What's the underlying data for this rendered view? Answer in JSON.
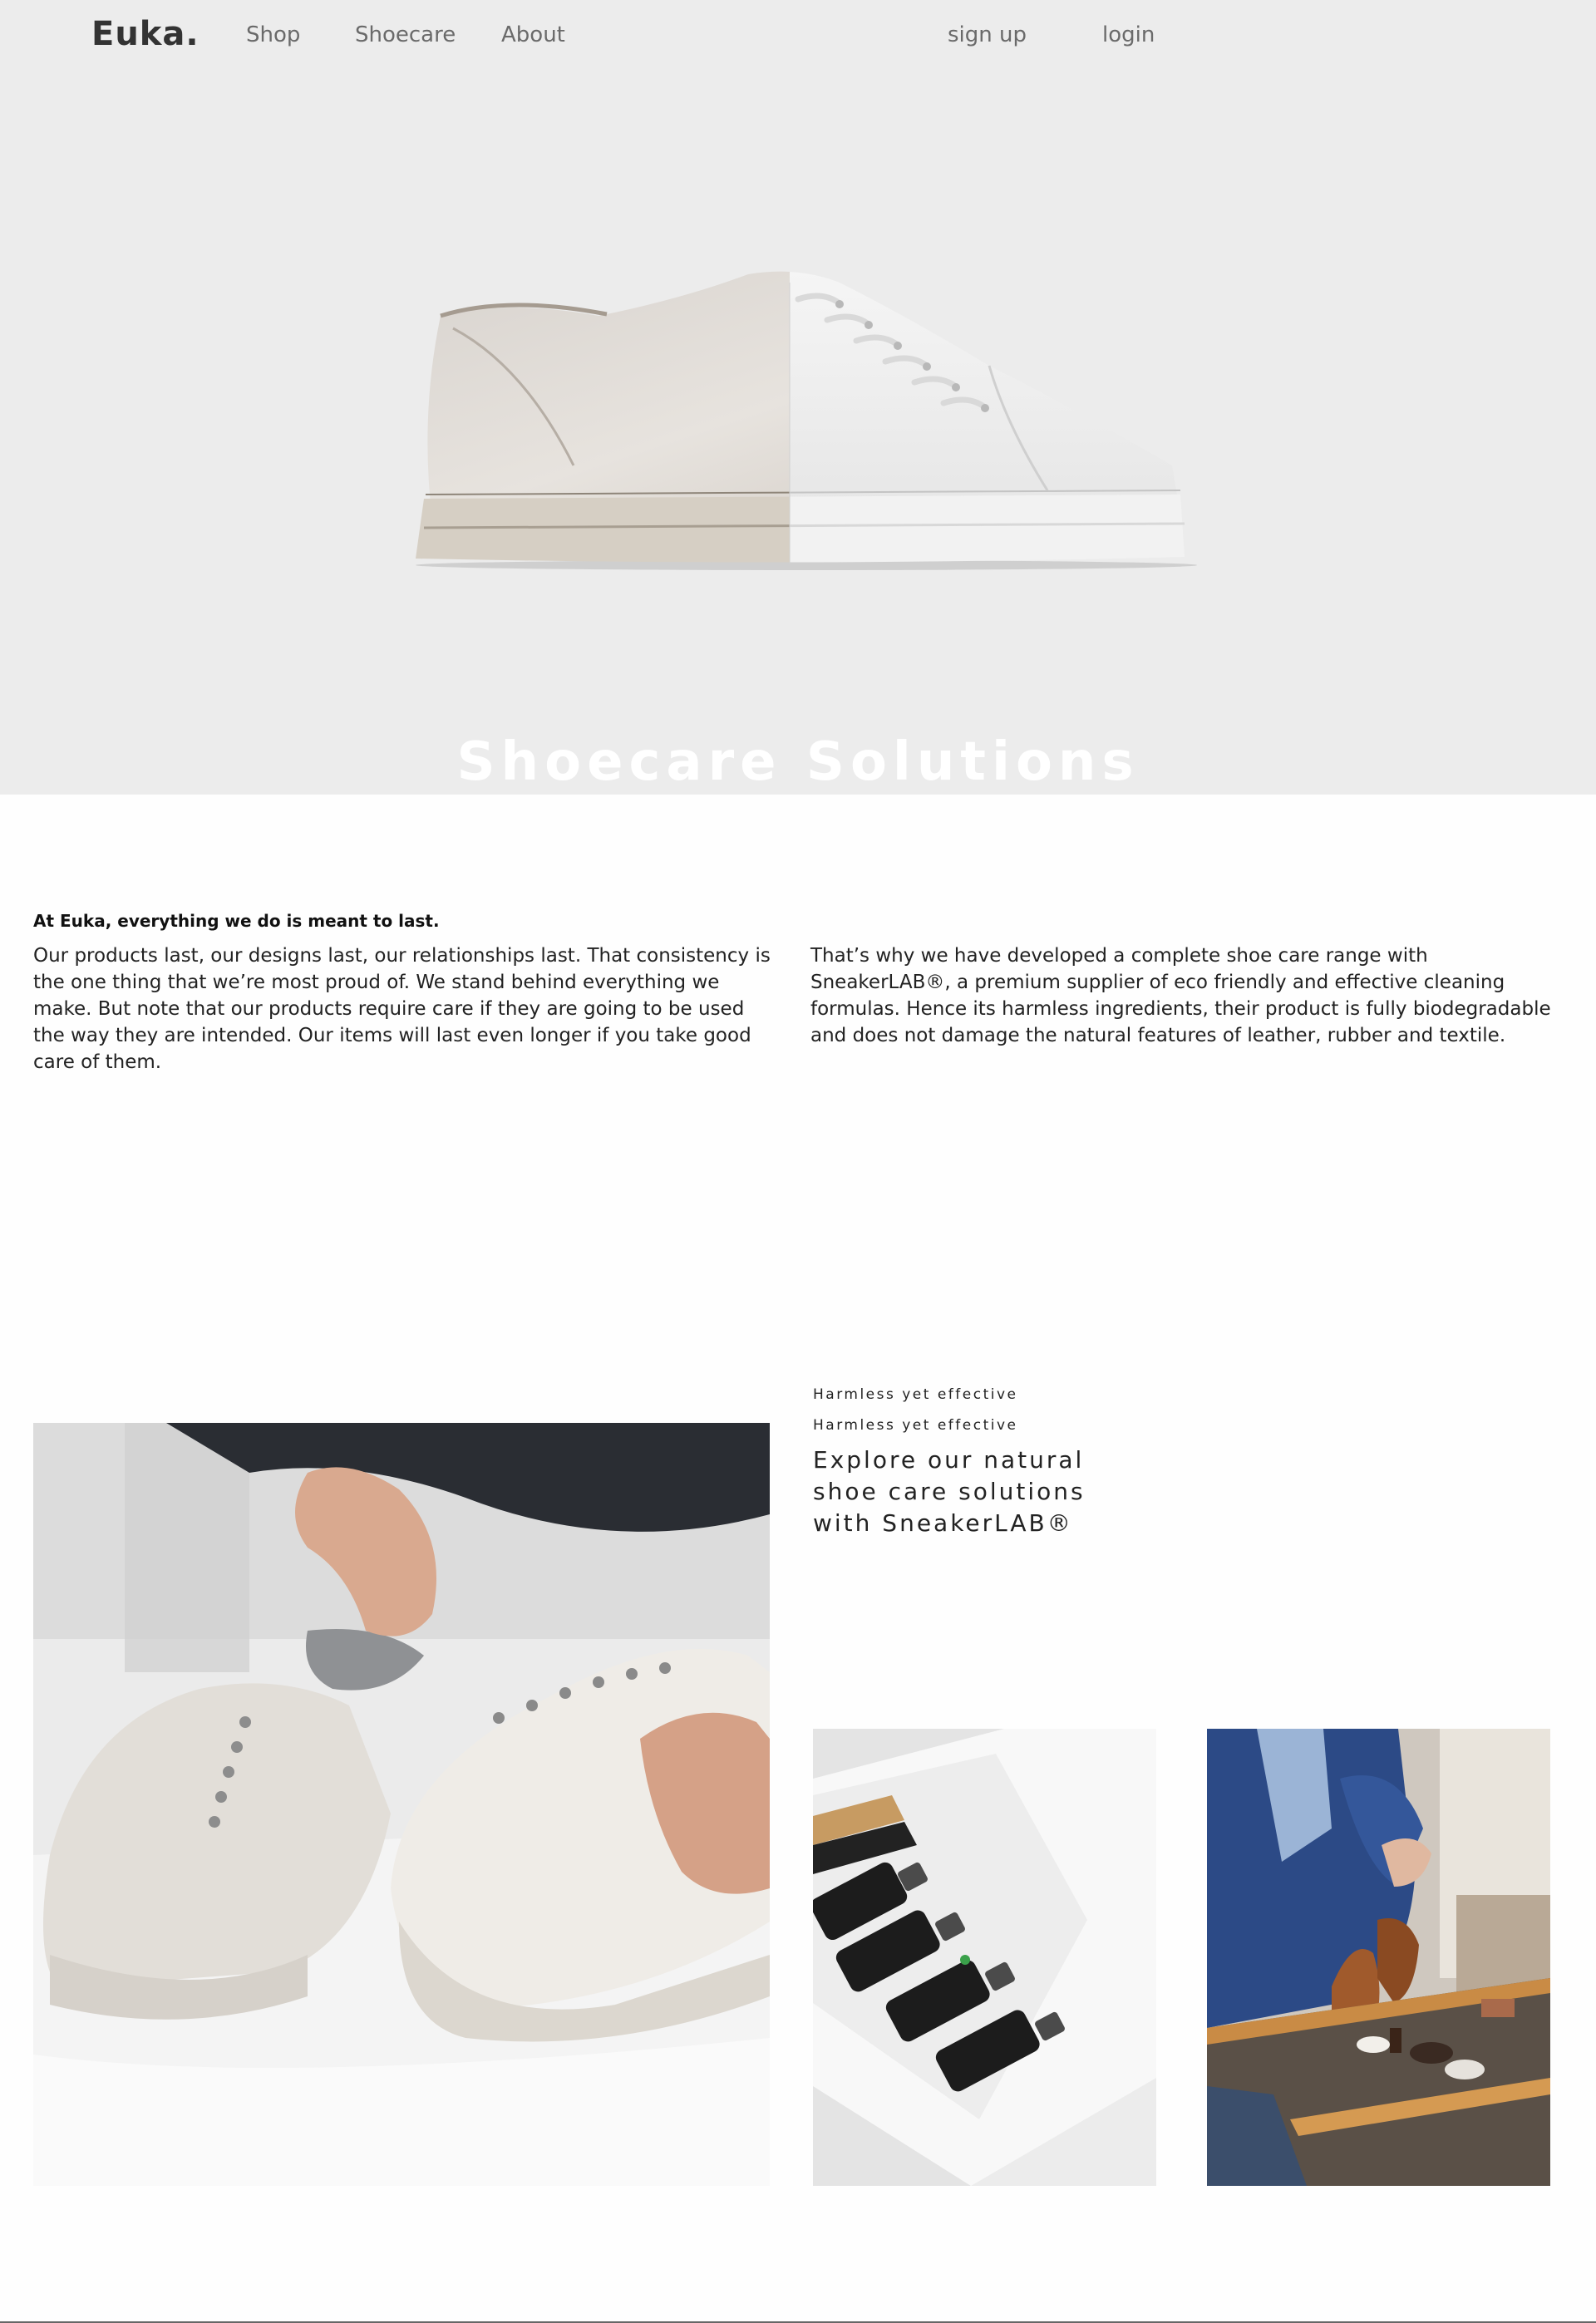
{
  "nav": {
    "logo": "Euka.",
    "links": [
      {
        "label": "Shop"
      },
      {
        "label": "Shoecare"
      },
      {
        "label": "About"
      }
    ],
    "signup_label": "sign up",
    "login_label": "login"
  },
  "hero": {
    "title": "Shoecare Solutions",
    "background_color": "#ececec"
  },
  "intro": {
    "lead": "At Euka, everything we do is meant to last.",
    "left_paragraph": "Our products last, our designs last, our relationships last. That consistency is the one thing that we’re most proud of. We stand behind everything we make. But note that our products require care if they are going to be used the way they are intended. Our items will last even longer if you take good care of them.",
    "right_paragraph": "That’s why we have developed a complete shoe care range with SneakerLAB®, a premium supplier of eco friendly and effective cleaning formulas. Hence its harmless ingredients, their product is fully biodegradable and does not damage the natural features of leather, rubber and textile."
  },
  "feature": {
    "eyebrow": "Harmless yet effective",
    "eyebrow_repeat": "Harmless yet effective",
    "heading": "Explore our natural shoe care solutions with SneakerLAB®"
  },
  "icons": {
    "hero_image": "sneaker-before-after-image",
    "main_photo": "cleaning-sneakers-photo",
    "kit_photo": "cleaning-kit-photo",
    "man_photo": "man-polishing-shoes-photo"
  }
}
